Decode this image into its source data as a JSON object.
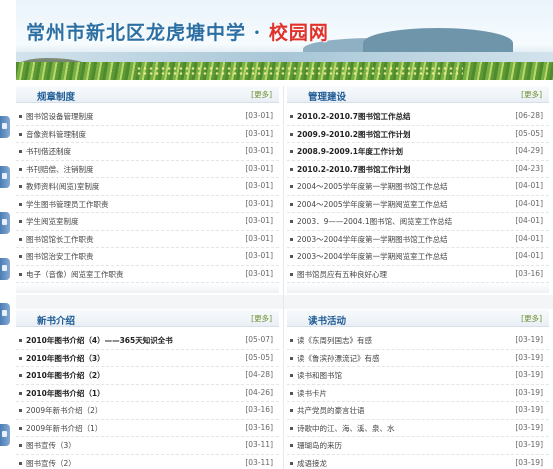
{
  "banner": {
    "title_main": "常州市新北区龙虎塘中学",
    "title_sep": "·",
    "title_accent": "校园网"
  },
  "panels": [
    {
      "title": "规章制度",
      "more": "更多",
      "items": [
        {
          "text": "图书馆设备管理制度",
          "date": "[03-01]",
          "bold": false
        },
        {
          "text": "音像资料管理制度",
          "date": "[03-01]",
          "bold": false
        },
        {
          "text": "书刊借还制度",
          "date": "[03-01]",
          "bold": false
        },
        {
          "text": "书刊赔偿、注销制度",
          "date": "[03-01]",
          "bold": false
        },
        {
          "text": "教师资料(阅览)室制度",
          "date": "[03-01]",
          "bold": false
        },
        {
          "text": "学生图书管理员工作职责",
          "date": "[03-01]",
          "bold": false
        },
        {
          "text": "学生阅览室制度",
          "date": "[03-01]",
          "bold": false
        },
        {
          "text": "图书馆馆长工作职责",
          "date": "[03-01]",
          "bold": false
        },
        {
          "text": "图书馆治安工作职责",
          "date": "[03-01]",
          "bold": false
        },
        {
          "text": "电子（音像）阅览室工作职责",
          "date": "[03-01]",
          "bold": false
        }
      ]
    },
    {
      "title": "管理建设",
      "more": "更多",
      "items": [
        {
          "text": "2010.2-2010.7图书馆工作总结",
          "date": "[06-28]",
          "bold": true
        },
        {
          "text": "2009.9-2010.2图书馆工作计划",
          "date": "[05-05]",
          "bold": true
        },
        {
          "text": "2008.9-2009.1年度工作计划",
          "date": "[04-29]",
          "bold": true
        },
        {
          "text": "2010.2-2010.7图书馆工作计划",
          "date": "[04-23]",
          "bold": true
        },
        {
          "text": "2004～2005学年度第一学期图书馆工作总结",
          "date": "[04-01]",
          "bold": false
        },
        {
          "text": "2004～2005学年度第一学期阅览室工作总结",
          "date": "[04-01]",
          "bold": false
        },
        {
          "text": "2003．9——2004.1图书馆、阅览室工作总结",
          "date": "[04-01]",
          "bold": false
        },
        {
          "text": "2003～2004学年度第一学期图书馆工作总结",
          "date": "[04-01]",
          "bold": false
        },
        {
          "text": "2003～2004学年度第一学期阅览室工作总结",
          "date": "[04-01]",
          "bold": false
        },
        {
          "text": "图书馆员应有五种良好心理",
          "date": "[03-16]",
          "bold": false
        }
      ]
    },
    {
      "title": "新书介绍",
      "more": "更多",
      "items": [
        {
          "text": "2010年图书介绍（4）——365天知识全书",
          "date": "[05-07]",
          "bold": true
        },
        {
          "text": "2010年图书介绍（3）",
          "date": "[05-05]",
          "bold": true
        },
        {
          "text": "2010年图书介绍（2）",
          "date": "[04-28]",
          "bold": true
        },
        {
          "text": "2010年图书介绍（1）",
          "date": "[04-26]",
          "bold": true
        },
        {
          "text": "2009年新书介绍（2）",
          "date": "[03-16]",
          "bold": false
        },
        {
          "text": "2009年新书介绍（1）",
          "date": "[03-16]",
          "bold": false
        },
        {
          "text": "图书宣传（3）",
          "date": "[03-11]",
          "bold": false
        },
        {
          "text": "图书宣传（2）",
          "date": "[03-11]",
          "bold": false
        }
      ]
    },
    {
      "title": "读书活动",
      "more": "更多",
      "items": [
        {
          "text": "读《东周列国志》有感",
          "date": "[03-19]",
          "bold": false
        },
        {
          "text": "读《鲁滨孙漂流记》有感",
          "date": "[03-19]",
          "bold": false
        },
        {
          "text": "读书和图书馆",
          "date": "[03-19]",
          "bold": false
        },
        {
          "text": "读书卡片",
          "date": "[03-19]",
          "bold": false
        },
        {
          "text": "共产党员的豪言壮语",
          "date": "[03-19]",
          "bold": false
        },
        {
          "text": "诗歌中的江、海、溪、泉、水",
          "date": "[03-19]",
          "bold": false
        },
        {
          "text": "珊瑚岛的来历",
          "date": "[03-19]",
          "bold": false
        },
        {
          "text": "成语接龙",
          "date": "[03-19]",
          "bold": false
        }
      ]
    }
  ]
}
